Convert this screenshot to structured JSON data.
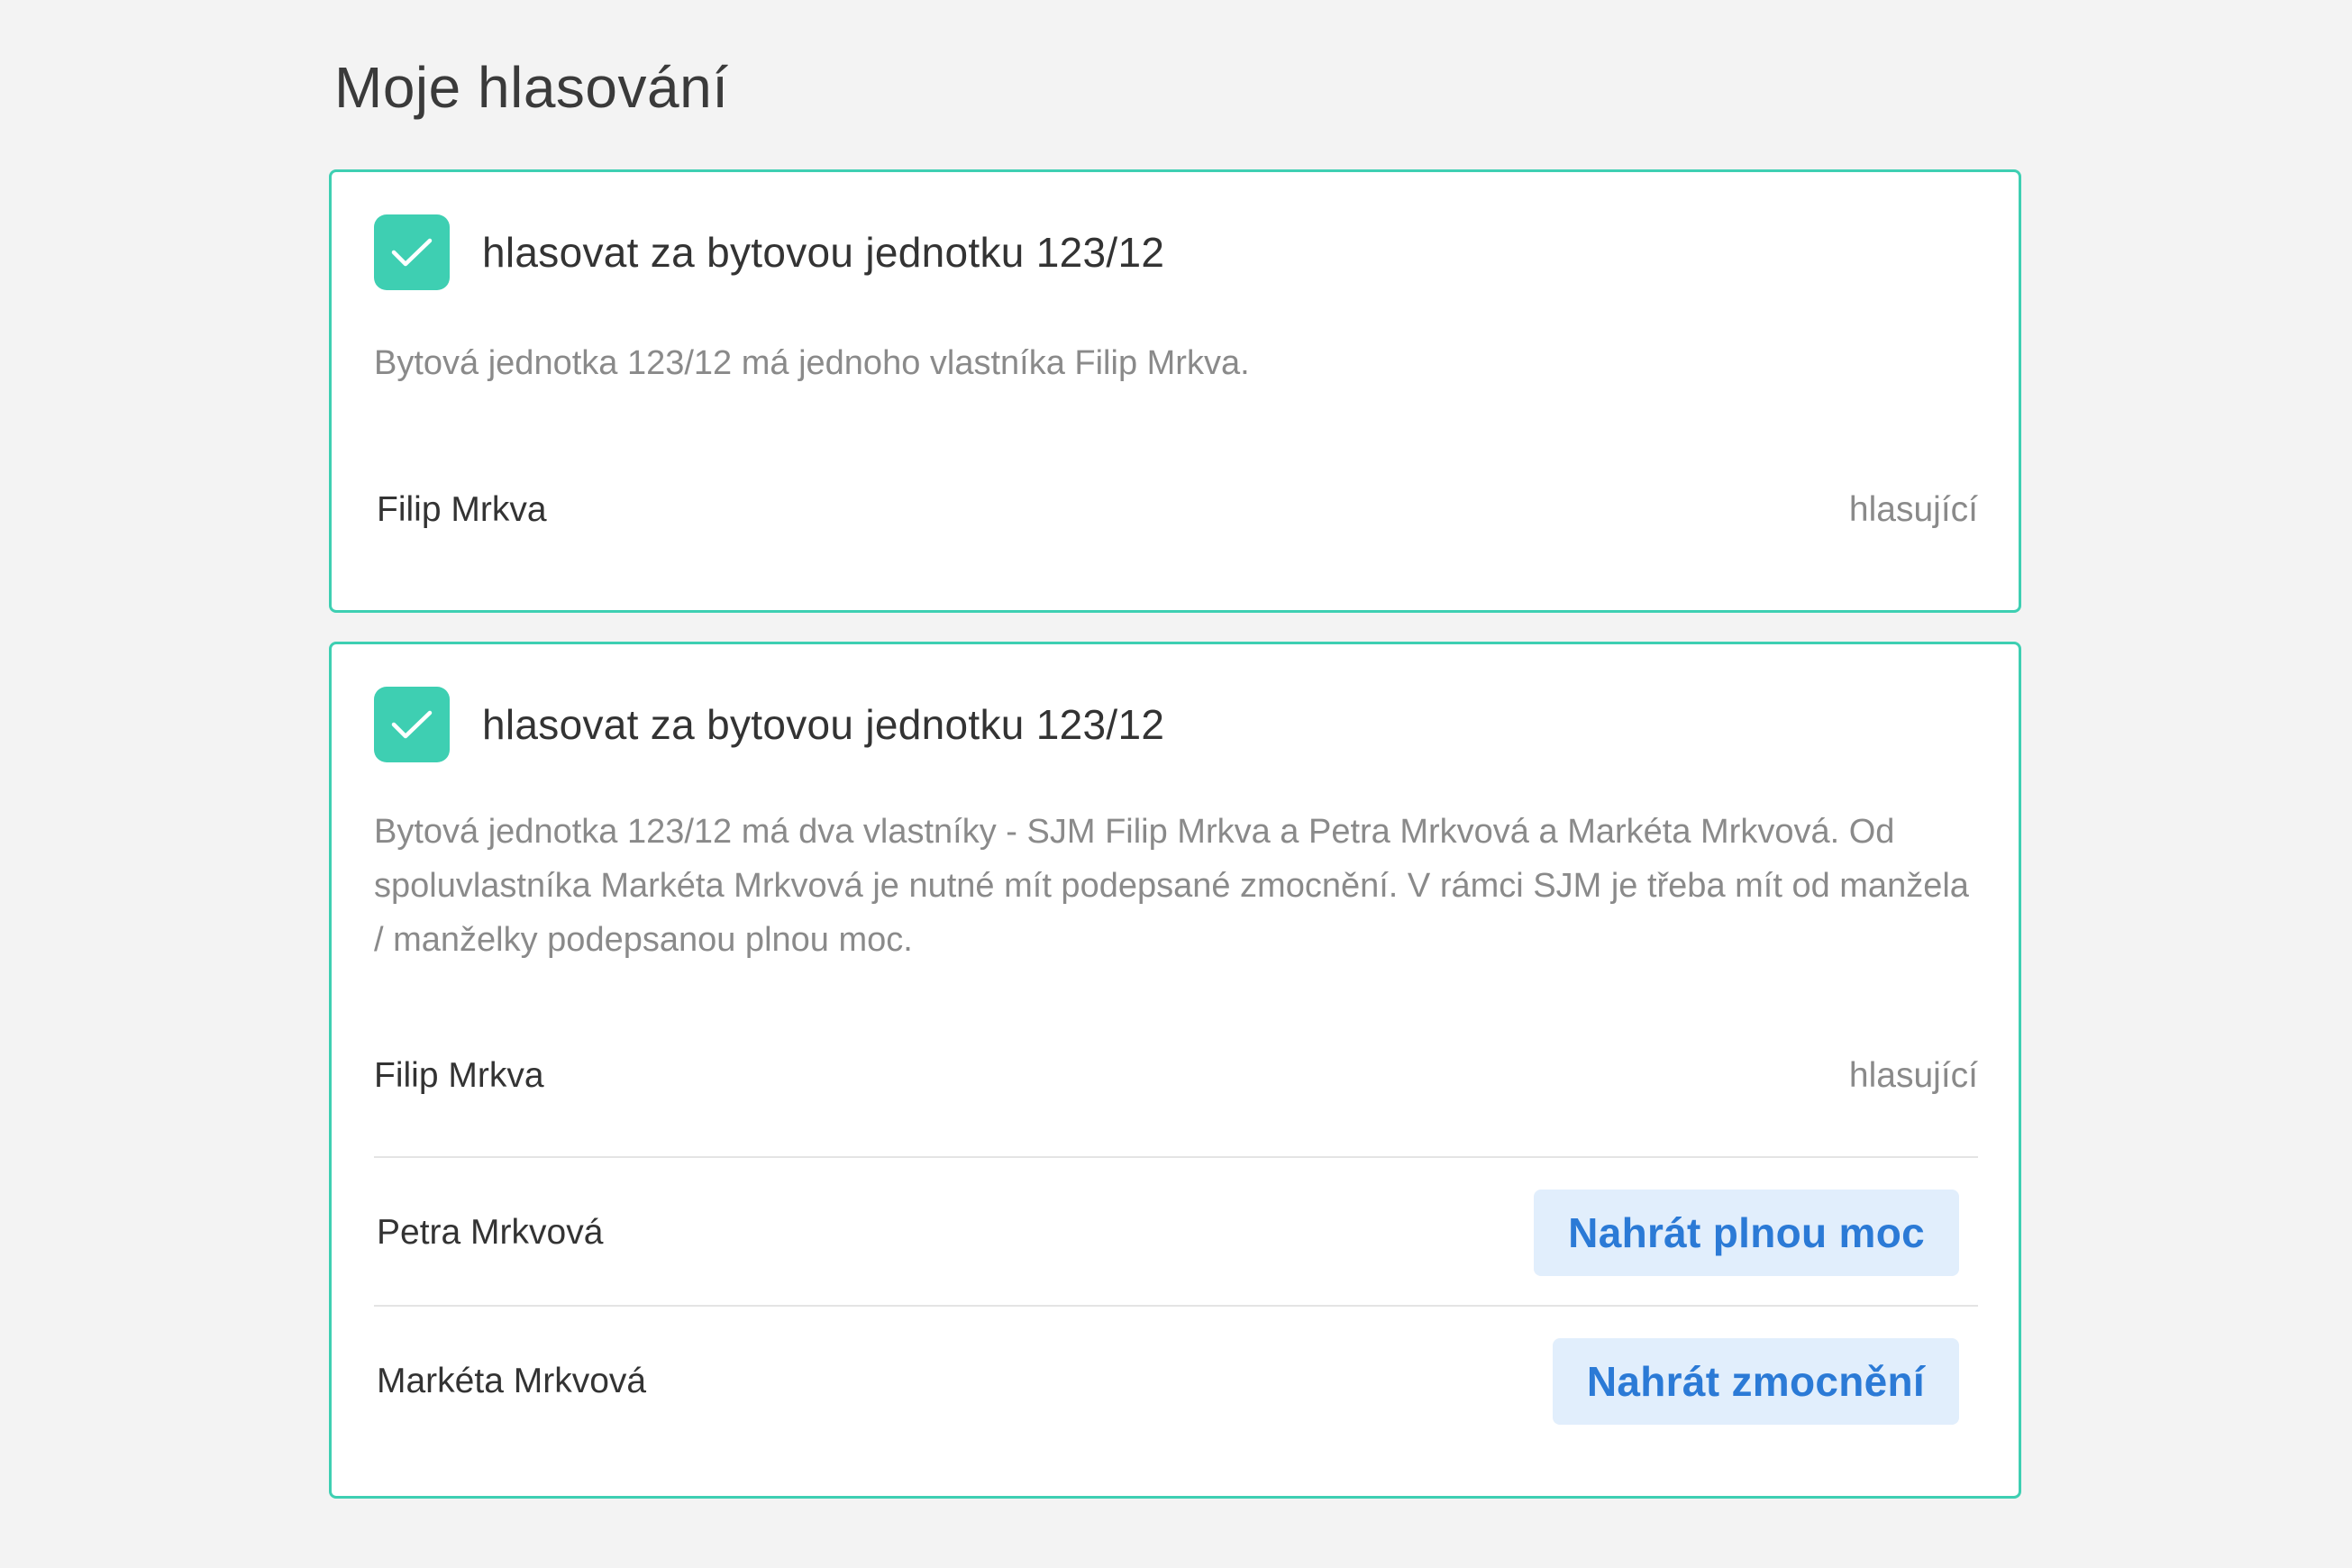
{
  "page": {
    "title": "Moje hlasování"
  },
  "colors": {
    "accent": "#3ecfb2",
    "button_bg": "#e1eefc",
    "button_text": "#2b7ad6",
    "muted_text": "#8a8a8a"
  },
  "cards": [
    {
      "checked": true,
      "title": "hlasovat za bytovou jednotku 123/12",
      "description": "Bytová jednotka 123/12 má jednoho vlastníka Filip Mrkva.",
      "owners": [
        {
          "name": "Filip Mrkva",
          "role": "hlasující"
        }
      ]
    },
    {
      "checked": true,
      "title": "hlasovat za bytovou jednotku 123/12",
      "description": "Bytová jednotka 123/12 má dva vlastníky - SJM Filip Mrkva a Petra Mrkvová a Markéta Mrkvová. Od spoluvlastníka Markéta Mrkvová je nutné mít podepsané zmocnění. V rámci SJM je třeba mít od manžela / manželky podepsanou plnou moc.",
      "owners": [
        {
          "name": "Filip Mrkva",
          "role": "hlasující"
        },
        {
          "name": "Petra Mrkvová",
          "action_label": "Nahrát plnou moc"
        },
        {
          "name": "Markéta Mrkvová",
          "action_label": "Nahrát zmocnění"
        }
      ]
    }
  ]
}
